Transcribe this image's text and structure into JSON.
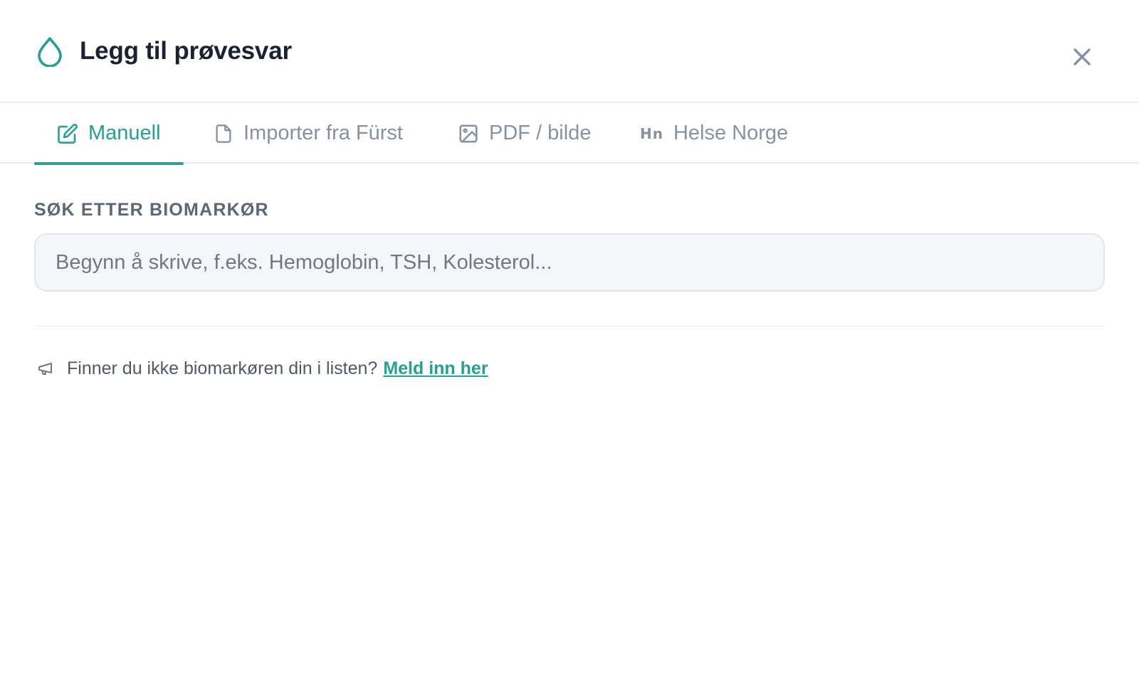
{
  "header": {
    "title": "Legg til prøvesvar",
    "icon": "droplet-icon",
    "close_icon": "close-icon"
  },
  "tabs": [
    {
      "label": "Manuell",
      "icon": "edit-icon",
      "active": true
    },
    {
      "label": "Importer fra Fürst",
      "icon": "file-icon",
      "active": false
    },
    {
      "label": "PDF / bilde",
      "icon": "image-icon",
      "active": false
    },
    {
      "label": "Helse Norge",
      "icon": "hn-logo-icon",
      "icon_text": "Hn",
      "active": false
    }
  ],
  "search": {
    "label": "SØK ETTER BIOMARKØR",
    "placeholder": "Begynn å skrive, f.eks. Hemoglobin, TSH, Kolesterol...",
    "value": ""
  },
  "note": {
    "text": "Finner du ikke biomarkøren din i listen?",
    "link_label": "Meld inn her",
    "icon": "megaphone-icon"
  },
  "colors": {
    "accent": "#26a091",
    "muted": "#8592a6",
    "text": "#1a2233"
  }
}
